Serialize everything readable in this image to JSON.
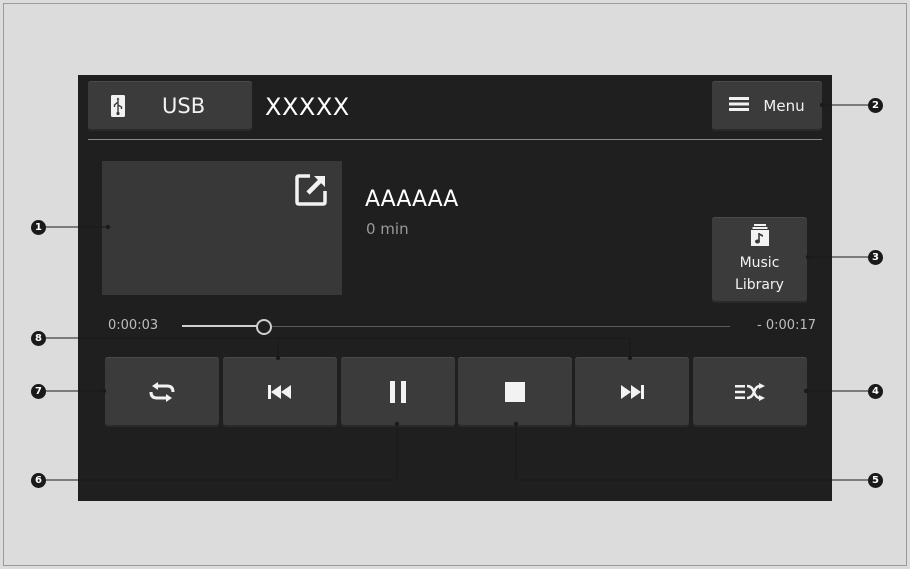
{
  "header": {
    "source_label": "USB",
    "title": "XXXXX",
    "menu_label": "Menu",
    "source_icon": "usb-icon",
    "menu_icon": "hamburger-icon"
  },
  "album": {
    "expand_icon": "expand-icon"
  },
  "track": {
    "title": "AAAAAA",
    "duration": "0 min"
  },
  "library": {
    "label_line1": "Music",
    "label_line2": "Library",
    "icon": "music-library-icon"
  },
  "progress": {
    "elapsed": "0:00:03",
    "remaining": "- 0:00:17",
    "fraction": 0.15
  },
  "controls": [
    {
      "name": "repeat-button",
      "icon": "repeat-icon"
    },
    {
      "name": "previous-track-button",
      "icon": "skip-back-icon"
    },
    {
      "name": "pause-button",
      "icon": "pause-icon"
    },
    {
      "name": "stop-button",
      "icon": "stop-icon"
    },
    {
      "name": "next-track-button",
      "icon": "skip-forward-icon"
    },
    {
      "name": "shuffle-button",
      "icon": "shuffle-icon"
    }
  ],
  "callouts": [
    "1",
    "2",
    "3",
    "4",
    "5",
    "6",
    "7",
    "8"
  ],
  "colors": {
    "screen_bg": "#1f1f1f",
    "button_bg": "#3b3b3b",
    "page_bg": "#dcdcdc"
  }
}
